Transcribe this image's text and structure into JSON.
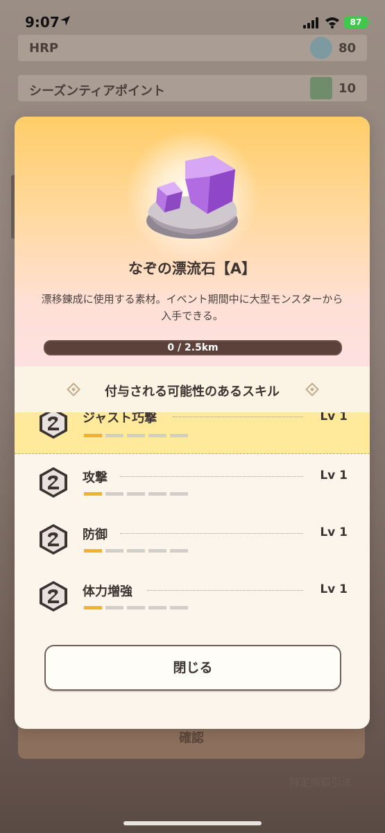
{
  "status_bar": {
    "time": "9:07",
    "battery": "87"
  },
  "background": {
    "rows": [
      {
        "label": "HRP",
        "value": "80"
      },
      {
        "label": "シーズンティアポイント",
        "value": "10"
      }
    ],
    "confirm_label": "確認",
    "link_text": "特定商取引法"
  },
  "modal": {
    "item_name": "なぞの漂流石【A】",
    "description": "漂移錬成に使用する素材。イベント期間中に大型モンスターから入手できる。",
    "progress": {
      "text": "0 / 2.5km",
      "fraction": 0.0
    },
    "skills_title": "付与される可能性のあるスキル",
    "skills": [
      {
        "name": "ジャスト巧撃",
        "level": "Lv 1",
        "level_value": 1,
        "max_level": 5
      },
      {
        "name": "攻撃",
        "level": "Lv 1",
        "level_value": 1,
        "max_level": 5
      },
      {
        "name": "防御",
        "level": "Lv 1",
        "level_value": 1,
        "max_level": 5
      },
      {
        "name": "体力増強",
        "level": "Lv 1",
        "level_value": 1,
        "max_level": 5
      }
    ],
    "close_label": "閉じる"
  },
  "colors": {
    "accent": "#f4b12e",
    "highlight": "#ffe99a"
  },
  "icons": [
    "location-arrow-icon",
    "cellular-signal-icon",
    "wifi-icon",
    "battery-icon",
    "crystal-stone-icon",
    "skill-hexagon-icon",
    "diamond-ornament-icon"
  ]
}
